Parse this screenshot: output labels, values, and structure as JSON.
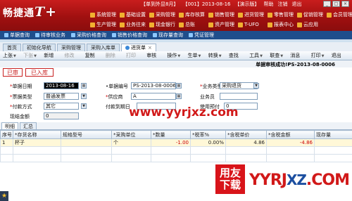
{
  "app": {
    "logo_text": "畅捷通",
    "logo_suffix": "T+",
    "info": [
      "【单到外显8月】",
      "【001】2013-08-16",
      "【演示版】"
    ],
    "header_links": [
      "帮助",
      "注销",
      "退出"
    ]
  },
  "menu_row1": [
    "系统管理",
    "基础设置",
    "采购管理",
    "库存核算",
    "销售管理",
    "进货管理",
    "零售管理",
    "促销管理",
    "会员管理"
  ],
  "menu_row2": [
    "生产管理",
    "业务往来",
    "现金银行",
    "总账",
    "资产管理",
    "T-UFO",
    "报表中心",
    "云应用"
  ],
  "quick_links": [
    "单据查询",
    "待审核业务",
    "采购价格查询",
    "销售价格查询",
    "现存量查询",
    "凭证管理"
  ],
  "tabs": [
    "首页",
    "初始化导航",
    "采购管理",
    "采购入库单",
    "进货单"
  ],
  "toolbar": [
    "上张",
    "下张",
    "新增",
    "修改",
    "复制",
    "删除",
    "打印",
    "审核",
    "操作",
    "生单",
    "转换",
    "查找",
    "工具",
    "联查",
    "消息",
    "打印",
    "退出"
  ],
  "status_message": "单据审核成功!PS-2013-08-0006",
  "stamps": {
    "audited": "已审",
    "stocked": "已入库"
  },
  "form": {
    "date_label": "单据日期",
    "date_value": "2013-08-16",
    "billno_label": "单据编号",
    "billno_value": "PS-2013-08-0006",
    "biztype_label": "业务类型",
    "biztype_value": "采购退货",
    "invoicetype_label": "票据类型",
    "invoicetype_value": "普通发票",
    "vendor_label": "供应商",
    "vendor_value": "A",
    "clerk_label": "业务员",
    "clerk_value": "",
    "paymethod_label": "付款方式",
    "paymethod_value": "其它",
    "duedate_label": "付款到期日",
    "duedate_value": "",
    "prepay_label": "使用预付",
    "prepay_value": "0",
    "cash_label": "现结金额",
    "cash_value": "0"
  },
  "grid_tabs": [
    "明细",
    "汇总"
  ],
  "table": {
    "headers": [
      "序号",
      "*存货名称",
      "规格型号",
      "*采购单位",
      "*数量",
      "*税率%",
      "*含税单价",
      "*含税金额",
      "现存量"
    ],
    "rows": [
      {
        "seq": "1",
        "name": "杯子",
        "spec": "",
        "unit": "个",
        "qty": "-1.00",
        "tax": "0.00%",
        "price": "4.86",
        "amount": "-4.86",
        "stock": ""
      }
    ]
  },
  "watermark": "www.yyrjxz.com",
  "brand": {
    "badge1": "用友",
    "badge2": "下载",
    "domain_red": "YYRJ",
    "domain_blue": "XZ",
    "domain_tail": ".COM"
  },
  "colors": {
    "header_red": "#b81515",
    "accent_blue": "#1f4e8c",
    "stamp_red": "#c82020"
  }
}
